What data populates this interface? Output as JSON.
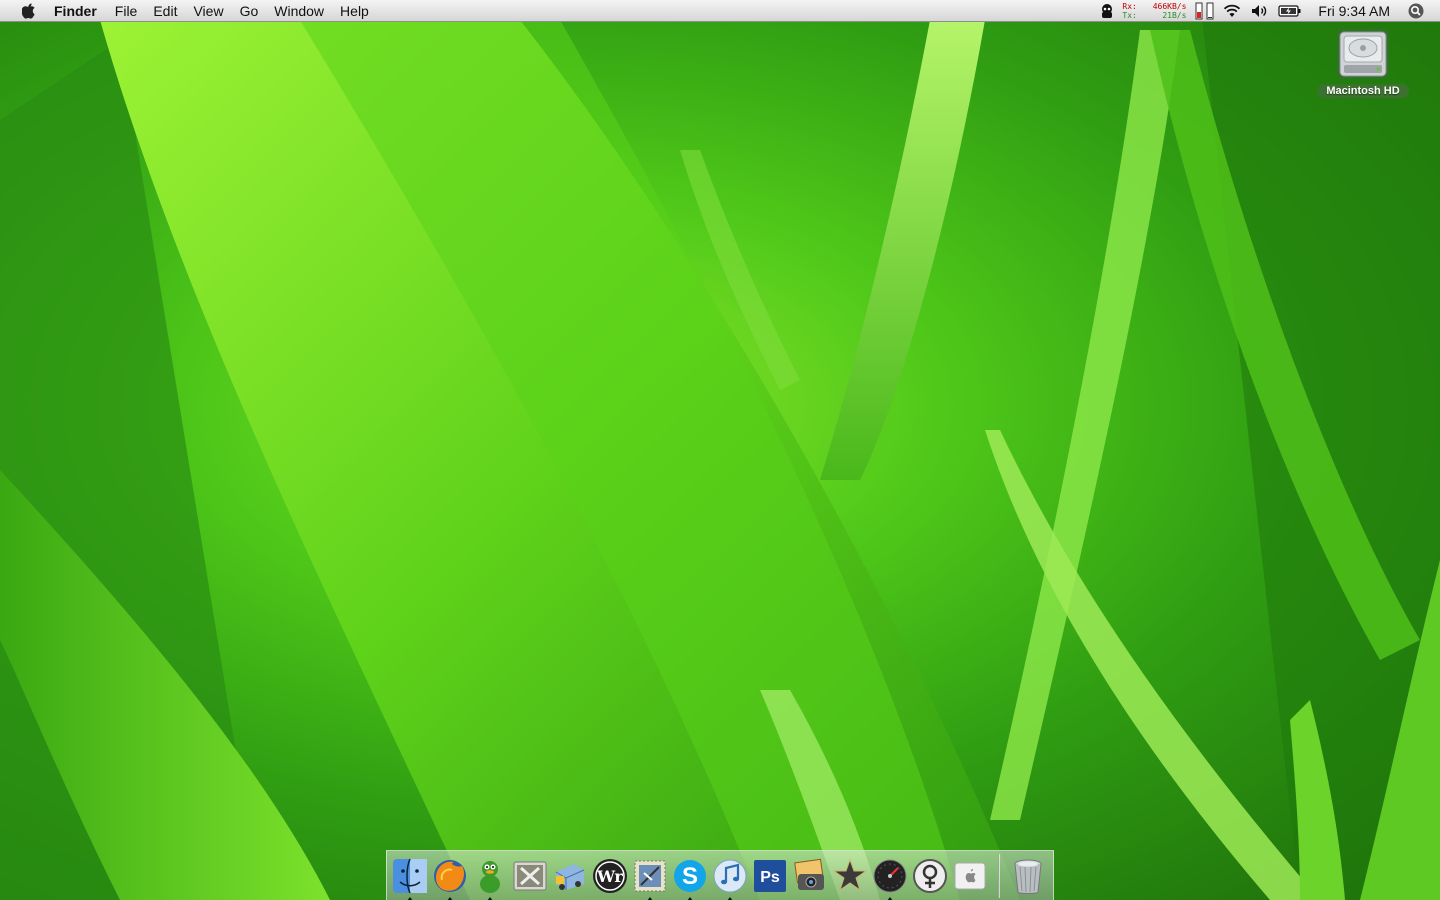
{
  "menubar": {
    "app_name": "Finder",
    "menus": [
      "File",
      "Edit",
      "View",
      "Go",
      "Window",
      "Help"
    ],
    "status": {
      "network": {
        "rx_label": "Rx:",
        "rx_value": "466KB/s",
        "tx_label": "Tx:",
        "tx_value": "21B/s"
      },
      "clock": "Fri 9:34 AM"
    },
    "icons": [
      "apple-icon",
      "spy-icon",
      "network-monitor",
      "memory-meter",
      "wifi-icon",
      "volume-icon",
      "battery-icon",
      "spotlight-icon"
    ]
  },
  "desktop": {
    "drive": {
      "label": "Macintosh HD",
      "icon": "hard-drive-icon"
    },
    "wallpaper": "green-grass",
    "colors": {
      "light_green": "#7fe020",
      "mid_green": "#3fb615",
      "dark_green": "#1b6a0a"
    }
  },
  "dock": {
    "items": [
      {
        "name": "finder",
        "running": true
      },
      {
        "name": "firefox",
        "running": true
      },
      {
        "name": "adium",
        "running": true
      },
      {
        "name": "x11",
        "running": false
      },
      {
        "name": "transmit",
        "running": false
      },
      {
        "name": "wordpress",
        "running": false
      },
      {
        "name": "mail",
        "running": true
      },
      {
        "name": "skype",
        "running": true
      },
      {
        "name": "itunes",
        "running": true
      },
      {
        "name": "photoshop",
        "running": false
      },
      {
        "name": "iphoto",
        "running": false
      },
      {
        "name": "imovie",
        "running": false
      },
      {
        "name": "dashboard",
        "running": true
      },
      {
        "name": "gender-app",
        "running": false
      },
      {
        "name": "apple-app",
        "running": false
      }
    ],
    "trash": {
      "name": "trash"
    }
  }
}
